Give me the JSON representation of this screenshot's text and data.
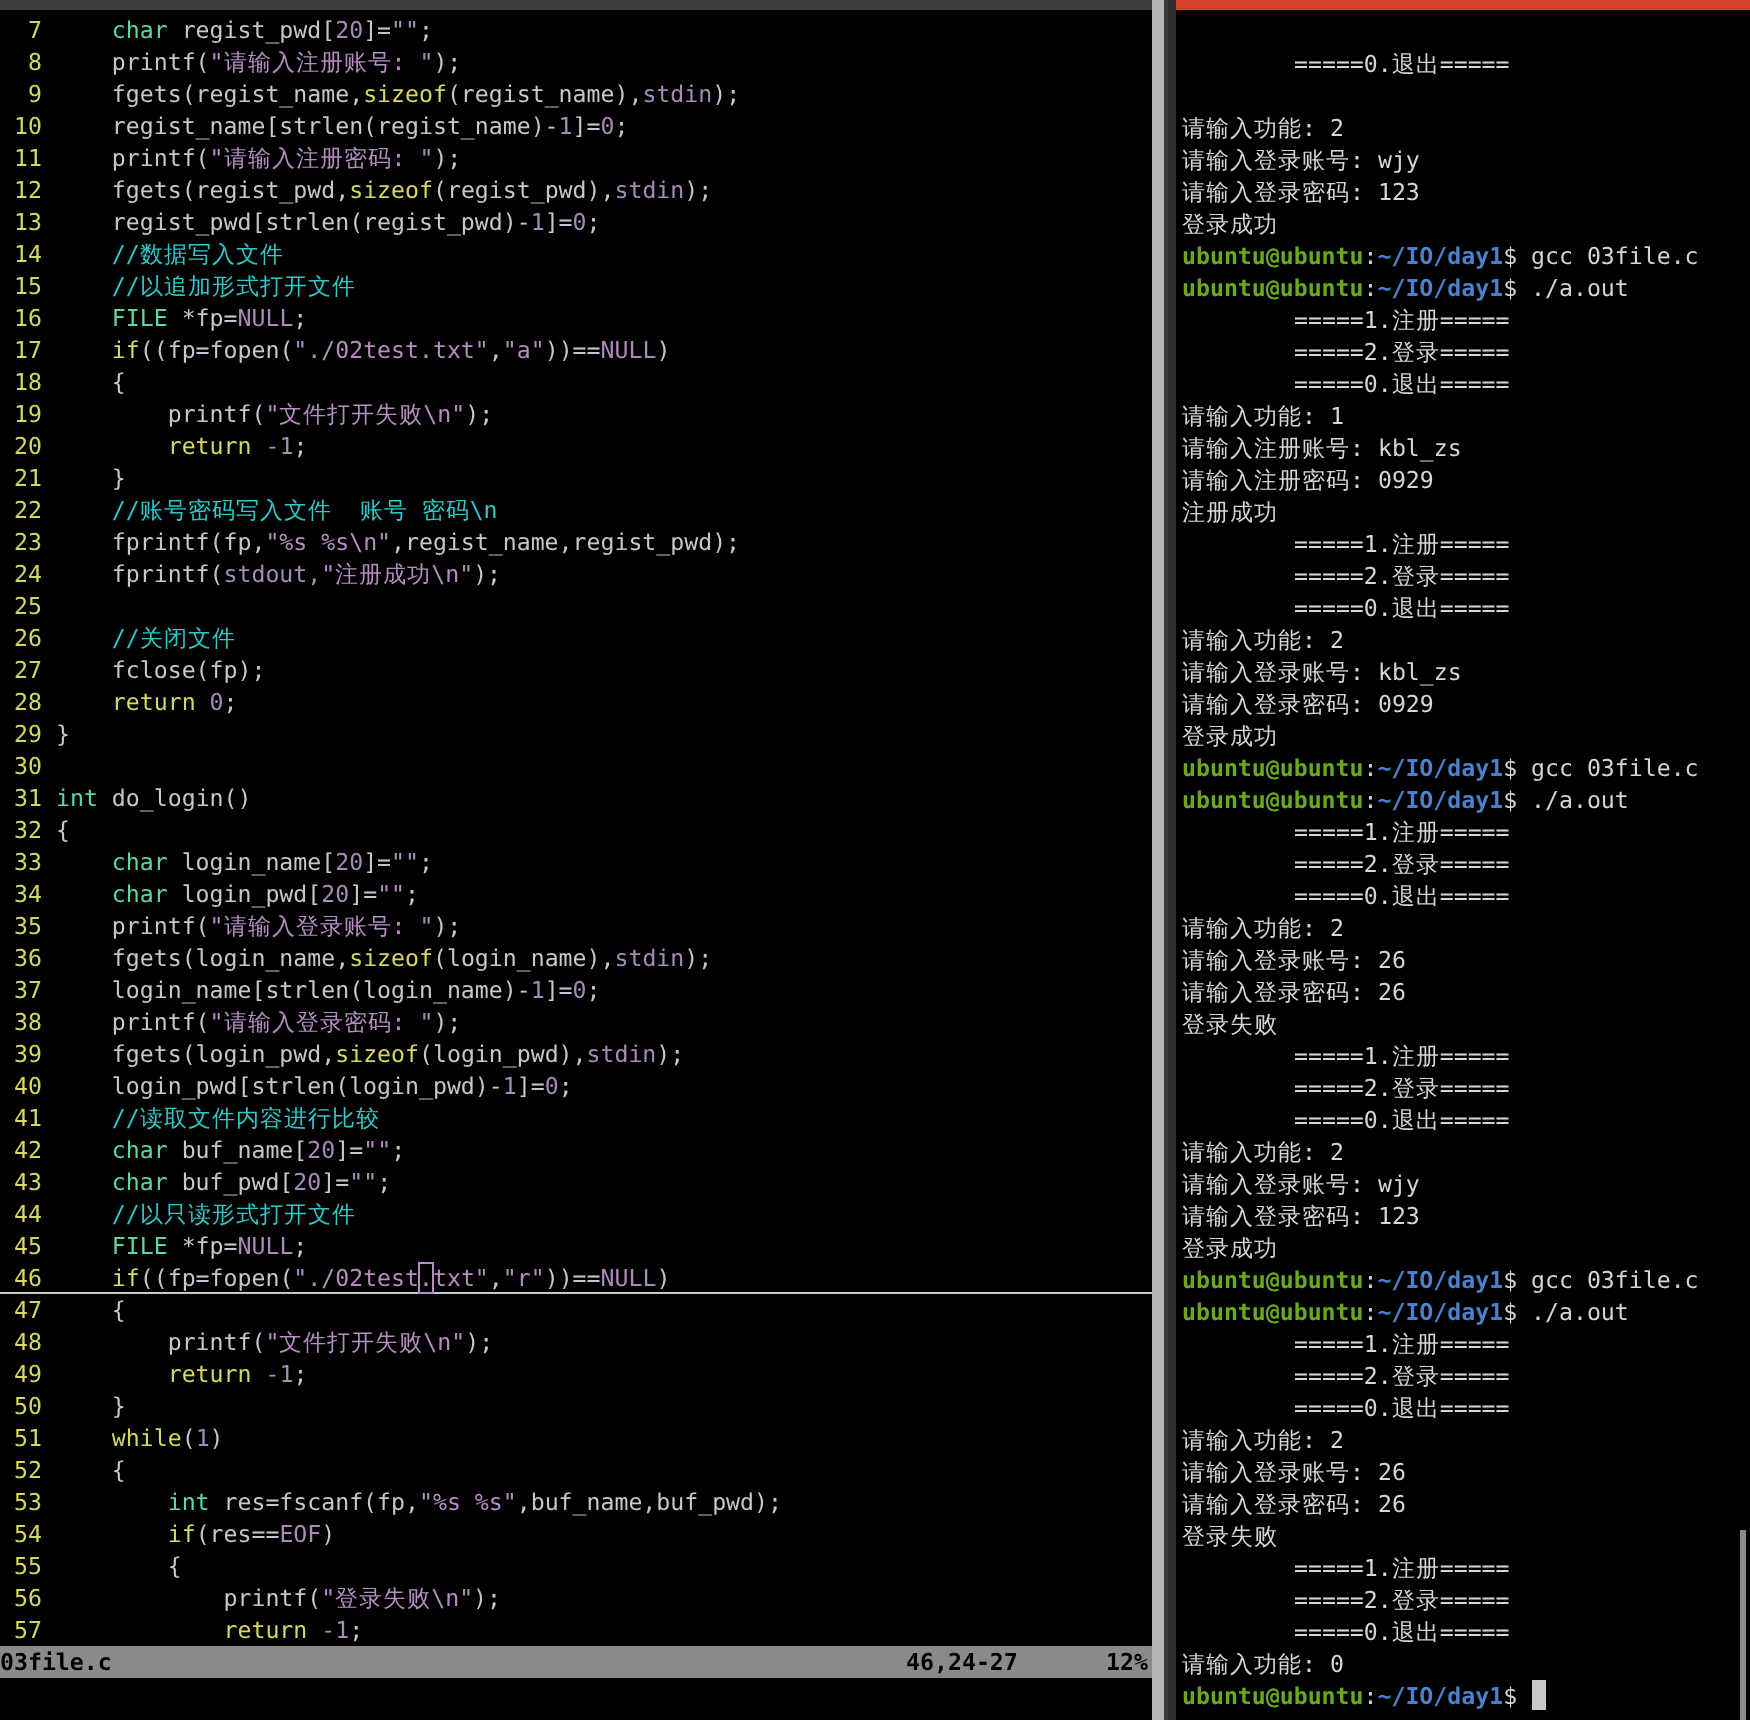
{
  "editor": {
    "lines": [
      {
        "num": "7",
        "tokens": [
          {
            "kind": "type",
            "text": "    char"
          },
          {
            "kind": "plain",
            "text": " regist_pwd["
          },
          {
            "kind": "number",
            "text": "20"
          },
          {
            "kind": "plain",
            "text": "]="
          },
          {
            "kind": "string",
            "text": "\"\""
          },
          {
            "kind": "plain",
            "text": ";"
          }
        ]
      },
      {
        "num": "8",
        "tokens": [
          {
            "kind": "plain",
            "text": "    printf("
          },
          {
            "kind": "string",
            "text": "\"请输入注册账号: \""
          },
          {
            "kind": "plain",
            "text": ");"
          }
        ]
      },
      {
        "num": "9",
        "tokens": [
          {
            "kind": "plain",
            "text": "    fgets(regist_name,"
          },
          {
            "kind": "keyword",
            "text": "sizeof"
          },
          {
            "kind": "plain",
            "text": "(regist_name),"
          },
          {
            "kind": "constant",
            "text": "stdin"
          },
          {
            "kind": "plain",
            "text": ");"
          }
        ]
      },
      {
        "num": "10",
        "tokens": [
          {
            "kind": "plain",
            "text": "    regist_name[strlen(regist_name)-"
          },
          {
            "kind": "number",
            "text": "1"
          },
          {
            "kind": "plain",
            "text": "]="
          },
          {
            "kind": "number",
            "text": "0"
          },
          {
            "kind": "plain",
            "text": ";"
          }
        ]
      },
      {
        "num": "11",
        "tokens": [
          {
            "kind": "plain",
            "text": "    printf("
          },
          {
            "kind": "string",
            "text": "\"请输入注册密码: \""
          },
          {
            "kind": "plain",
            "text": ");"
          }
        ]
      },
      {
        "num": "12",
        "tokens": [
          {
            "kind": "plain",
            "text": "    fgets(regist_pwd,"
          },
          {
            "kind": "keyword",
            "text": "sizeof"
          },
          {
            "kind": "plain",
            "text": "(regist_pwd),"
          },
          {
            "kind": "constant",
            "text": "stdin"
          },
          {
            "kind": "plain",
            "text": ");"
          }
        ]
      },
      {
        "num": "13",
        "tokens": [
          {
            "kind": "plain",
            "text": "    regist_pwd[strlen(regist_pwd)-"
          },
          {
            "kind": "number",
            "text": "1"
          },
          {
            "kind": "plain",
            "text": "]="
          },
          {
            "kind": "number",
            "text": "0"
          },
          {
            "kind": "plain",
            "text": ";"
          }
        ]
      },
      {
        "num": "14",
        "tokens": [
          {
            "kind": "comment",
            "text": "    //数据写入文件"
          }
        ]
      },
      {
        "num": "15",
        "tokens": [
          {
            "kind": "comment",
            "text": "    //以追加形式打开文件"
          }
        ]
      },
      {
        "num": "16",
        "tokens": [
          {
            "kind": "type",
            "text": "    FILE"
          },
          {
            "kind": "plain",
            "text": " *fp="
          },
          {
            "kind": "constant",
            "text": "NULL"
          },
          {
            "kind": "plain",
            "text": ";"
          }
        ]
      },
      {
        "num": "17",
        "tokens": [
          {
            "kind": "keyword",
            "text": "    if"
          },
          {
            "kind": "plain",
            "text": "((fp=fopen("
          },
          {
            "kind": "string",
            "text": "\"./02test.txt\""
          },
          {
            "kind": "plain",
            "text": ","
          },
          {
            "kind": "string",
            "text": "\"a\""
          },
          {
            "kind": "plain",
            "text": "))=="
          },
          {
            "kind": "constant",
            "text": "NULL"
          },
          {
            "kind": "plain",
            "text": ")"
          }
        ]
      },
      {
        "num": "18",
        "tokens": [
          {
            "kind": "plain",
            "text": "    {"
          }
        ]
      },
      {
        "num": "19",
        "tokens": [
          {
            "kind": "plain",
            "text": "        printf("
          },
          {
            "kind": "string",
            "text": "\"文件打开失败\\n\""
          },
          {
            "kind": "plain",
            "text": ");"
          }
        ]
      },
      {
        "num": "20",
        "tokens": [
          {
            "kind": "keyword",
            "text": "        return"
          },
          {
            "kind": "number",
            "text": " -1"
          },
          {
            "kind": "plain",
            "text": ";"
          }
        ]
      },
      {
        "num": "21",
        "tokens": [
          {
            "kind": "plain",
            "text": "    }"
          }
        ]
      },
      {
        "num": "22",
        "tokens": [
          {
            "kind": "comment",
            "text": "    //账号密码写入文件  账号 密码\\n"
          }
        ]
      },
      {
        "num": "23",
        "tokens": [
          {
            "kind": "plain",
            "text": "    fprintf(fp,"
          },
          {
            "kind": "string",
            "text": "\"%s %s\\n\""
          },
          {
            "kind": "plain",
            "text": ",regist_name,regist_pwd);"
          }
        ]
      },
      {
        "num": "24",
        "tokens": [
          {
            "kind": "plain",
            "text": "    fprintf("
          },
          {
            "kind": "constant",
            "text": "stdout,"
          },
          {
            "kind": "string",
            "text": "\"注册成功\\n\""
          },
          {
            "kind": "plain",
            "text": ");"
          }
        ]
      },
      {
        "num": "25"
      },
      {
        "num": "26",
        "tokens": [
          {
            "kind": "comment",
            "text": "    //关闭文件"
          }
        ]
      },
      {
        "num": "27",
        "tokens": [
          {
            "kind": "plain",
            "text": "    fclose(fp);"
          }
        ]
      },
      {
        "num": "28",
        "tokens": [
          {
            "kind": "keyword",
            "text": "    return"
          },
          {
            "kind": "number",
            "text": " 0"
          },
          {
            "kind": "plain",
            "text": ";"
          }
        ]
      },
      {
        "num": "29",
        "tokens": [
          {
            "kind": "plain",
            "text": "}"
          }
        ]
      },
      {
        "num": "30"
      },
      {
        "num": "31",
        "tokens": [
          {
            "kind": "type",
            "text": "int"
          },
          {
            "kind": "plain",
            "text": " do_login()"
          }
        ]
      },
      {
        "num": "32",
        "tokens": [
          {
            "kind": "plain",
            "text": "{"
          }
        ]
      },
      {
        "num": "33",
        "tokens": [
          {
            "kind": "type",
            "text": "    char"
          },
          {
            "kind": "plain",
            "text": " login_name["
          },
          {
            "kind": "number",
            "text": "20"
          },
          {
            "kind": "plain",
            "text": "]="
          },
          {
            "kind": "string",
            "text": "\"\""
          },
          {
            "kind": "plain",
            "text": ";"
          }
        ]
      },
      {
        "num": "34",
        "tokens": [
          {
            "kind": "type",
            "text": "    char"
          },
          {
            "kind": "plain",
            "text": " login_pwd["
          },
          {
            "kind": "number",
            "text": "20"
          },
          {
            "kind": "plain",
            "text": "]="
          },
          {
            "kind": "string",
            "text": "\"\""
          },
          {
            "kind": "plain",
            "text": ";"
          }
        ]
      },
      {
        "num": "35",
        "tokens": [
          {
            "kind": "plain",
            "text": "    printf("
          },
          {
            "kind": "string",
            "text": "\"请输入登录账号: \""
          },
          {
            "kind": "plain",
            "text": ");"
          }
        ]
      },
      {
        "num": "36",
        "tokens": [
          {
            "kind": "plain",
            "text": "    fgets(login_name,"
          },
          {
            "kind": "keyword",
            "text": "sizeof"
          },
          {
            "kind": "plain",
            "text": "(login_name),"
          },
          {
            "kind": "constant",
            "text": "stdin"
          },
          {
            "kind": "plain",
            "text": ");"
          }
        ]
      },
      {
        "num": "37",
        "tokens": [
          {
            "kind": "plain",
            "text": "    login_name[strlen(login_name)-"
          },
          {
            "kind": "number",
            "text": "1"
          },
          {
            "kind": "plain",
            "text": "]="
          },
          {
            "kind": "number",
            "text": "0"
          },
          {
            "kind": "plain",
            "text": ";"
          }
        ]
      },
      {
        "num": "38",
        "tokens": [
          {
            "kind": "plain",
            "text": "    printf("
          },
          {
            "kind": "string",
            "text": "\"请输入登录密码: \""
          },
          {
            "kind": "plain",
            "text": ");"
          }
        ]
      },
      {
        "num": "39",
        "tokens": [
          {
            "kind": "plain",
            "text": "    fgets(login_pwd,"
          },
          {
            "kind": "keyword",
            "text": "sizeof"
          },
          {
            "kind": "plain",
            "text": "(login_pwd),"
          },
          {
            "kind": "constant",
            "text": "stdin"
          },
          {
            "kind": "plain",
            "text": ");"
          }
        ]
      },
      {
        "num": "40",
        "tokens": [
          {
            "kind": "plain",
            "text": "    login_pwd[strlen(login_pwd)-"
          },
          {
            "kind": "number",
            "text": "1"
          },
          {
            "kind": "plain",
            "text": "]="
          },
          {
            "kind": "number",
            "text": "0"
          },
          {
            "kind": "plain",
            "text": ";"
          }
        ]
      },
      {
        "num": "41",
        "tokens": [
          {
            "kind": "comment",
            "text": "    //读取文件内容进行比较"
          }
        ]
      },
      {
        "num": "42",
        "tokens": [
          {
            "kind": "type",
            "text": "    char"
          },
          {
            "kind": "plain",
            "text": " buf_name["
          },
          {
            "kind": "number",
            "text": "20"
          },
          {
            "kind": "plain",
            "text": "]="
          },
          {
            "kind": "string",
            "text": "\"\""
          },
          {
            "kind": "plain",
            "text": ";"
          }
        ]
      },
      {
        "num": "43",
        "tokens": [
          {
            "kind": "type",
            "text": "    char"
          },
          {
            "kind": "plain",
            "text": " buf_pwd["
          },
          {
            "kind": "number",
            "text": "20"
          },
          {
            "kind": "plain",
            "text": "]="
          },
          {
            "kind": "string",
            "text": "\"\""
          },
          {
            "kind": "plain",
            "text": ";"
          }
        ]
      },
      {
        "num": "44",
        "tokens": [
          {
            "kind": "comment",
            "text": "    //以只读形式打开文件"
          }
        ]
      },
      {
        "num": "45",
        "tokens": [
          {
            "kind": "type",
            "text": "    FILE"
          },
          {
            "kind": "plain",
            "text": " *fp="
          },
          {
            "kind": "constant",
            "text": "NULL"
          },
          {
            "kind": "plain",
            "text": ";"
          }
        ]
      },
      {
        "num": "46",
        "current": true,
        "tokens": [
          {
            "kind": "keyword",
            "text": "    if"
          },
          {
            "kind": "plain",
            "text": "((fp=fopen("
          },
          {
            "kind": "string",
            "text": "\"./02test"
          },
          {
            "kind": "cursor",
            "text": "."
          },
          {
            "kind": "string",
            "text": "txt\""
          },
          {
            "kind": "plain",
            "text": ","
          },
          {
            "kind": "string",
            "text": "\"r\""
          },
          {
            "kind": "plain",
            "text": "))=="
          },
          {
            "kind": "constant",
            "text": "NULL"
          },
          {
            "kind": "plain",
            "text": ")"
          }
        ]
      },
      {
        "num": "47",
        "tokens": [
          {
            "kind": "plain",
            "text": "    {"
          }
        ]
      },
      {
        "num": "48",
        "tokens": [
          {
            "kind": "plain",
            "text": "        printf("
          },
          {
            "kind": "string",
            "text": "\"文件打开失败\\n\""
          },
          {
            "kind": "plain",
            "text": ");"
          }
        ]
      },
      {
        "num": "49",
        "tokens": [
          {
            "kind": "keyword",
            "text": "        return"
          },
          {
            "kind": "number",
            "text": " -1"
          },
          {
            "kind": "plain",
            "text": ";"
          }
        ]
      },
      {
        "num": "50",
        "tokens": [
          {
            "kind": "plain",
            "text": "    }"
          }
        ]
      },
      {
        "num": "51",
        "tokens": [
          {
            "kind": "keyword",
            "text": "    while"
          },
          {
            "kind": "plain",
            "text": "("
          },
          {
            "kind": "number",
            "text": "1"
          },
          {
            "kind": "plain",
            "text": ")"
          }
        ]
      },
      {
        "num": "52",
        "tokens": [
          {
            "kind": "plain",
            "text": "    {"
          }
        ]
      },
      {
        "num": "53",
        "tokens": [
          {
            "kind": "type",
            "text": "        int"
          },
          {
            "kind": "plain",
            "text": " res=fscanf(fp,"
          },
          {
            "kind": "string",
            "text": "\"%s %s\""
          },
          {
            "kind": "plain",
            "text": ",buf_name,buf_pwd);"
          }
        ]
      },
      {
        "num": "54",
        "tokens": [
          {
            "kind": "keyword",
            "text": "        if"
          },
          {
            "kind": "plain",
            "text": "(res=="
          },
          {
            "kind": "constant",
            "text": "EOF"
          },
          {
            "kind": "plain",
            "text": ")"
          }
        ]
      },
      {
        "num": "55",
        "tokens": [
          {
            "kind": "plain",
            "text": "        {"
          }
        ]
      },
      {
        "num": "56",
        "tokens": [
          {
            "kind": "plain",
            "text": "            printf("
          },
          {
            "kind": "string",
            "text": "\"登录失败\\n\""
          },
          {
            "kind": "plain",
            "text": ");"
          }
        ]
      },
      {
        "num": "57",
        "tokens": [
          {
            "kind": "keyword",
            "text": "            return"
          },
          {
            "kind": "number",
            "text": " -1"
          },
          {
            "kind": "plain",
            "text": ";"
          }
        ]
      }
    ],
    "status_bar": {
      "file": "03file.c",
      "position": "46,24-27",
      "percent": "12%"
    }
  },
  "terminal": {
    "lines": [
      {
        "kind": "menu",
        "text": "=====0.退出====="
      },
      {
        "kind": "blank"
      },
      {
        "kind": "text",
        "text": "请输入功能: 2"
      },
      {
        "kind": "text",
        "text": "请输入登录账号: wjy"
      },
      {
        "kind": "text",
        "text": "请输入登录密码: 123"
      },
      {
        "kind": "text",
        "text": "登录成功"
      },
      {
        "kind": "prompt",
        "user": "ubuntu@ubuntu",
        "separator": ":",
        "path": "~/IO/day1",
        "command": "$ gcc 03file.c"
      },
      {
        "kind": "prompt",
        "user": "ubuntu@ubuntu",
        "separator": ":",
        "path": "~/IO/day1",
        "command": "$ ./a.out"
      },
      {
        "kind": "menu",
        "text": "=====1.注册====="
      },
      {
        "kind": "menu",
        "text": "=====2.登录====="
      },
      {
        "kind": "menu",
        "text": "=====0.退出====="
      },
      {
        "kind": "text",
        "text": "请输入功能: 1"
      },
      {
        "kind": "text",
        "text": "请输入注册账号: kbl_zs"
      },
      {
        "kind": "text",
        "text": "请输入注册密码: 0929"
      },
      {
        "kind": "text",
        "text": "注册成功"
      },
      {
        "kind": "menu",
        "text": "=====1.注册====="
      },
      {
        "kind": "menu",
        "text": "=====2.登录====="
      },
      {
        "kind": "menu",
        "text": "=====0.退出====="
      },
      {
        "kind": "text",
        "text": "请输入功能: 2"
      },
      {
        "kind": "text",
        "text": "请输入登录账号: kbl_zs"
      },
      {
        "kind": "text",
        "text": "请输入登录密码: 0929"
      },
      {
        "kind": "text",
        "text": "登录成功"
      },
      {
        "kind": "prompt",
        "user": "ubuntu@ubuntu",
        "separator": ":",
        "path": "~/IO/day1",
        "command": "$ gcc 03file.c"
      },
      {
        "kind": "prompt",
        "user": "ubuntu@ubuntu",
        "separator": ":",
        "path": "~/IO/day1",
        "command": "$ ./a.out"
      },
      {
        "kind": "menu",
        "text": "=====1.注册====="
      },
      {
        "kind": "menu",
        "text": "=====2.登录====="
      },
      {
        "kind": "menu",
        "text": "=====0.退出====="
      },
      {
        "kind": "text",
        "text": "请输入功能: 2"
      },
      {
        "kind": "text",
        "text": "请输入登录账号: 26"
      },
      {
        "kind": "text",
        "text": "请输入登录密码: 26"
      },
      {
        "kind": "text",
        "text": "登录失败"
      },
      {
        "kind": "menu",
        "text": "=====1.注册====="
      },
      {
        "kind": "menu",
        "text": "=====2.登录====="
      },
      {
        "kind": "menu",
        "text": "=====0.退出====="
      },
      {
        "kind": "text",
        "text": "请输入功能: 2"
      },
      {
        "kind": "text",
        "text": "请输入登录账号: wjy"
      },
      {
        "kind": "text",
        "text": "请输入登录密码: 123"
      },
      {
        "kind": "text",
        "text": "登录成功"
      },
      {
        "kind": "prompt",
        "user": "ubuntu@ubuntu",
        "separator": ":",
        "path": "~/IO/day1",
        "command": "$ gcc 03file.c"
      },
      {
        "kind": "prompt",
        "user": "ubuntu@ubuntu",
        "separator": ":",
        "path": "~/IO/day1",
        "command": "$ ./a.out"
      },
      {
        "kind": "menu",
        "text": "=====1.注册====="
      },
      {
        "kind": "menu",
        "text": "=====2.登录====="
      },
      {
        "kind": "menu",
        "text": "=====0.退出====="
      },
      {
        "kind": "text",
        "text": "请输入功能: 2"
      },
      {
        "kind": "text",
        "text": "请输入登录账号: 26"
      },
      {
        "kind": "text",
        "text": "请输入登录密码: 26"
      },
      {
        "kind": "text",
        "text": "登录失败"
      },
      {
        "kind": "menu",
        "text": "=====1.注册====="
      },
      {
        "kind": "menu",
        "text": "=====2.登录====="
      },
      {
        "kind": "menu",
        "text": "=====0.退出====="
      },
      {
        "kind": "text",
        "text": "请输入功能: 0"
      },
      {
        "kind": "prompt",
        "user": "ubuntu@ubuntu",
        "separator": ":",
        "path": "~/IO/day1",
        "command": "$",
        "cursor": true
      }
    ]
  }
}
